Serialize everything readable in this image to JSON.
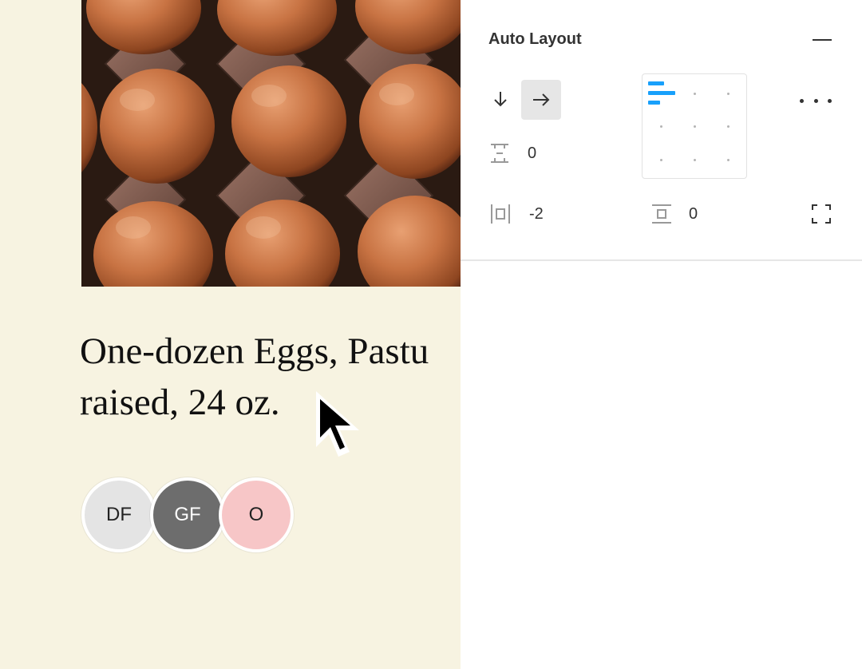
{
  "product": {
    "title": "One-dozen Eggs, Pastu\nraised, 24 oz.",
    "badges": [
      "DF",
      "GF",
      "O"
    ]
  },
  "panel": {
    "title": "Auto Layout",
    "spacing_between": "0",
    "horizontal_padding": "-2",
    "vertical_padding": "0",
    "direction_selected": "horizontal"
  },
  "icons": {
    "collapse": "minus-icon",
    "vertical": "arrow-down-icon",
    "horizontal": "arrow-right-icon",
    "more": "ellipsis-icon",
    "spacing": "spacing-between-icon",
    "h_padding": "horizontal-padding-icon",
    "v_padding": "vertical-padding-icon",
    "resizing": "resizing-icon"
  },
  "colors": {
    "canvas": "#f7f3e1",
    "accent": "#18a0fb",
    "selected_button": "#e6e6e6"
  }
}
